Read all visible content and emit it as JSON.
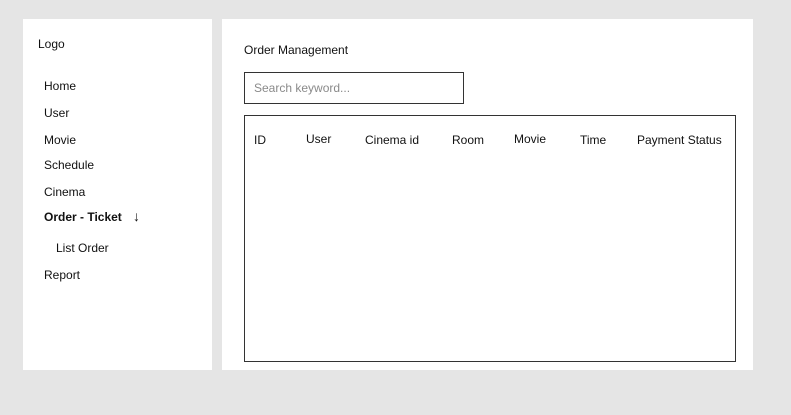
{
  "sidebar": {
    "logo": "Logo",
    "items": [
      {
        "label": "Home"
      },
      {
        "label": "User"
      },
      {
        "label": "Movie"
      },
      {
        "label": "Schedule"
      },
      {
        "label": "Cinema"
      },
      {
        "label": "Order - Ticket",
        "active": true,
        "icon": "arrow-down-icon",
        "icon_glyph": "↓"
      },
      {
        "label": "List Order",
        "sub": true
      },
      {
        "label": "Report"
      }
    ]
  },
  "main": {
    "title": "Order Management",
    "search": {
      "placeholder": "Search keyword...",
      "value": ""
    },
    "table": {
      "columns": [
        "ID",
        "User",
        "Cinema id",
        "Room",
        "Movie",
        "Time",
        "Payment Status"
      ],
      "rows": []
    }
  }
}
